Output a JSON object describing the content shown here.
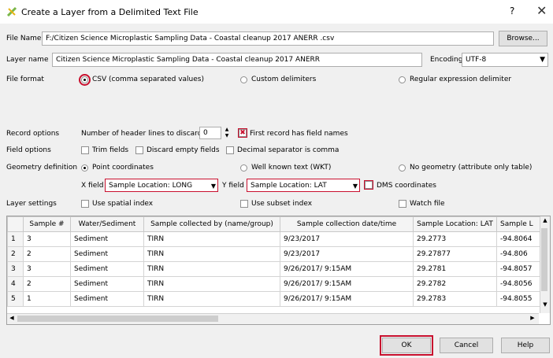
{
  "window": {
    "title": "Create a Layer from a Delimited Text File",
    "help_glyph": "?",
    "close_glyph": "✕"
  },
  "file": {
    "label": "File Name",
    "value": "F:/Citizen Science Microplastic Sampling Data - Coastal cleanup 2017 ANERR .csv",
    "browse_label": "Browse..."
  },
  "layer": {
    "label": "Layer name",
    "value": "Citizen Science Microplastic Sampling Data - Coastal cleanup 2017 ANERR",
    "encoding_label": "Encoding",
    "encoding_value": "UTF-8"
  },
  "file_format": {
    "label": "File format",
    "options": [
      "CSV (comma separated values)",
      "Custom delimiters",
      "Regular expression delimiter"
    ],
    "selected": "CSV (comma separated values)"
  },
  "record_options": {
    "label": "Record options",
    "header_lines_label": "Number of header lines to discard",
    "header_lines_value": "0",
    "first_record_label": "First record has field names",
    "first_record_checked": true
  },
  "field_options": {
    "label": "Field options",
    "trim": "Trim fields",
    "discard_empty": "Discard empty fields",
    "decimal_comma": "Decimal separator is comma"
  },
  "geometry": {
    "label": "Geometry definition",
    "options": [
      "Point coordinates",
      "Well known text (WKT)",
      "No geometry (attribute only table)"
    ],
    "selected": "Point coordinates",
    "x_label": "X field",
    "x_value": "Sample Location: LONG",
    "y_label": "Y field",
    "y_value": "Sample Location: LAT",
    "dms_label": "DMS coordinates"
  },
  "layer_settings": {
    "label": "Layer settings",
    "spatial_index": "Use spatial index",
    "subset_index": "Use subset index",
    "watch_file": "Watch file"
  },
  "table": {
    "columns": [
      "Sample #",
      "Water/Sediment",
      "Sample collected by (name/group)",
      "Sample collection date/time",
      "Sample Location: LAT",
      "Sample L"
    ],
    "rows": [
      {
        "n": "1",
        "cells": [
          "3",
          "Sediment",
          "TIRN",
          "9/23/2017",
          "29.2773",
          "-94.8064"
        ]
      },
      {
        "n": "2",
        "cells": [
          "2",
          "Sediment",
          "TIRN",
          "9/23/2017",
          "29.27877",
          "-94.806"
        ]
      },
      {
        "n": "3",
        "cells": [
          "3",
          "Sediment",
          "TIRN",
          "9/26/2017/ 9:15AM",
          "29.2781",
          "-94.8057"
        ]
      },
      {
        "n": "4",
        "cells": [
          "2",
          "Sediment",
          "TIRN",
          "9/26/2017/ 9:15AM",
          "29.2782",
          "-94.8056"
        ]
      },
      {
        "n": "5",
        "cells": [
          "1",
          "Sediment",
          "TIRN",
          "9/26/2017/ 9:15AM",
          "29.2783",
          "-94.8055"
        ]
      }
    ]
  },
  "buttons": {
    "ok": "OK",
    "cancel": "Cancel",
    "help": "Help"
  },
  "colors": {
    "highlight": "#c8102e",
    "check_red": "#c8102e"
  }
}
